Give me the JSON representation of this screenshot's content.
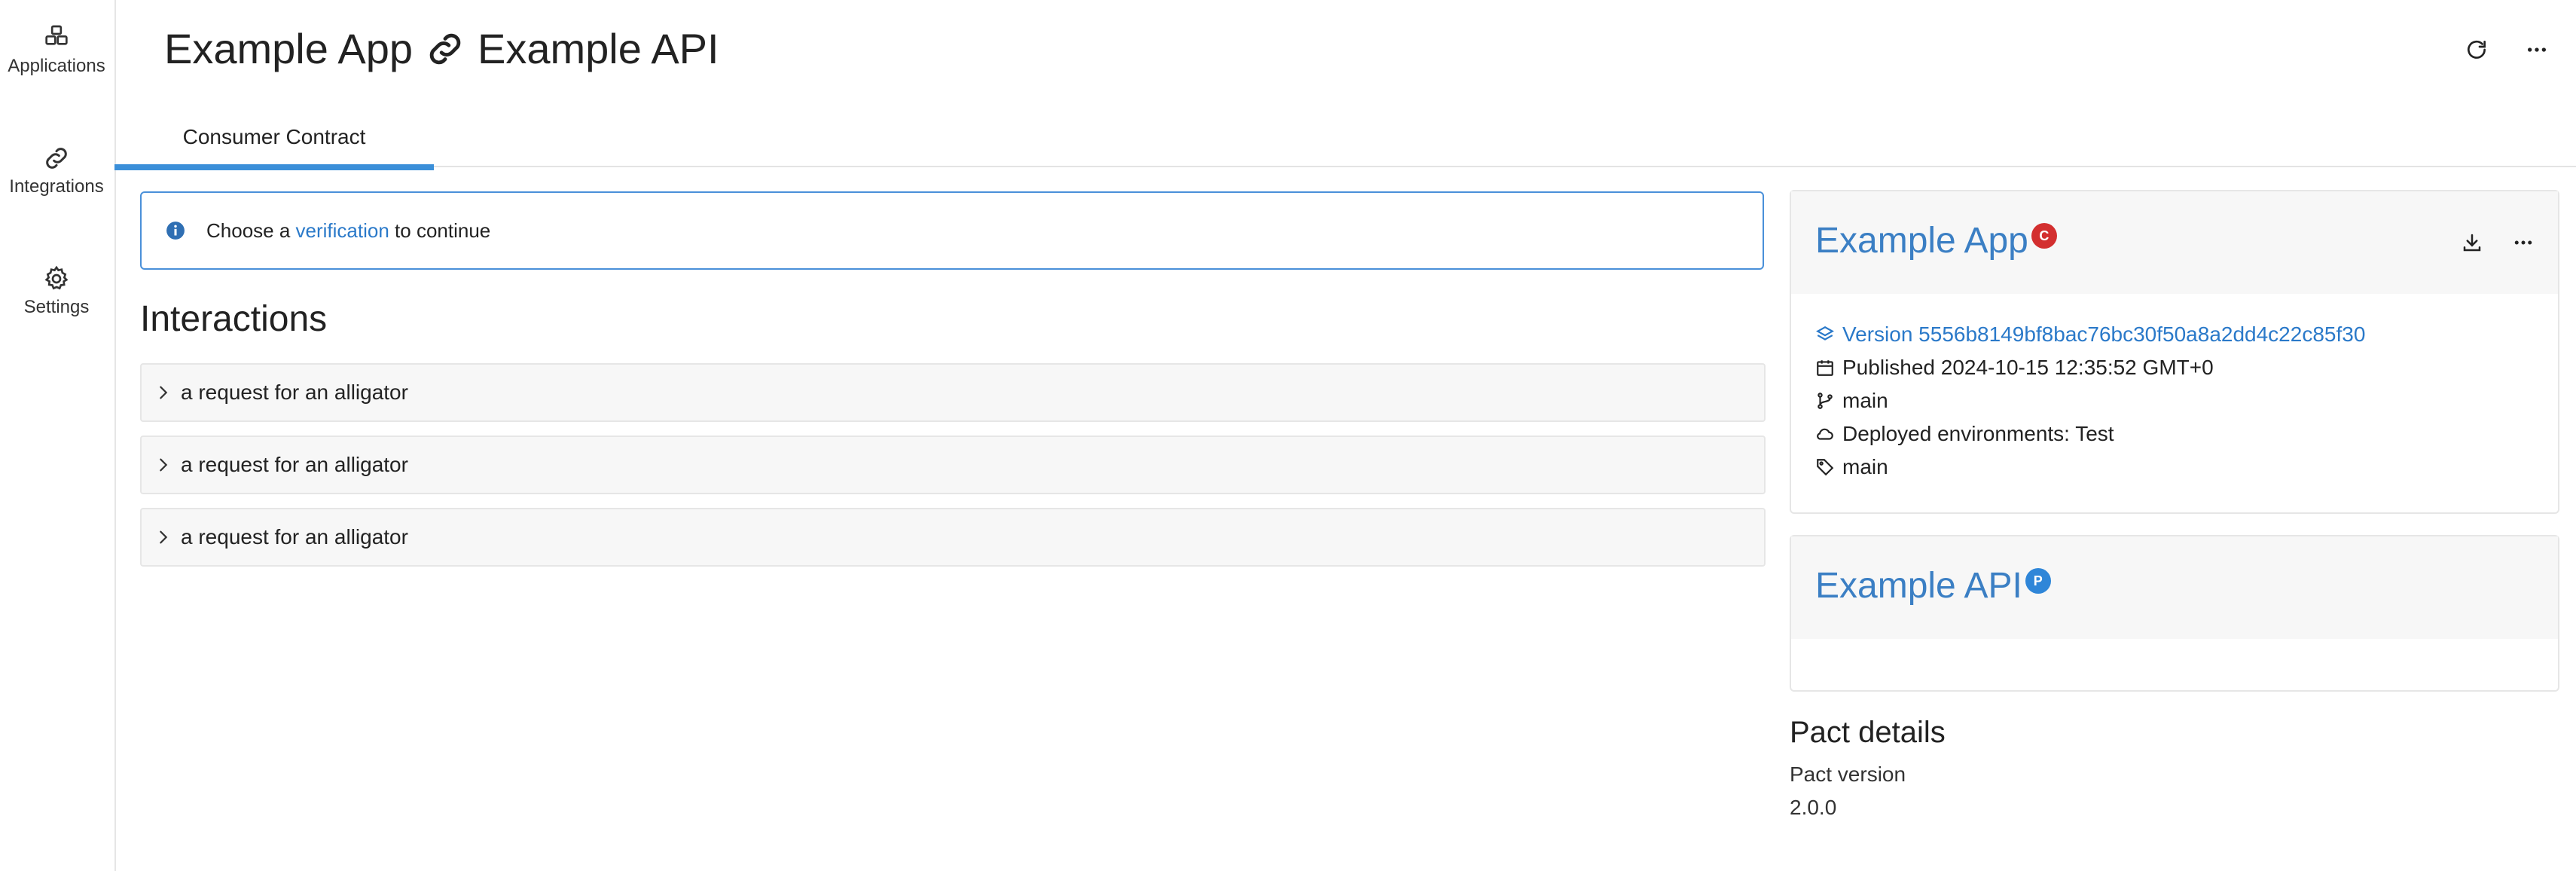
{
  "sidebar": {
    "items": [
      {
        "label": "Applications",
        "icon": "boxes-icon"
      },
      {
        "label": "Integrations",
        "icon": "link-icon"
      },
      {
        "label": "Settings",
        "icon": "gear-icon"
      }
    ]
  },
  "header": {
    "consumer": "Example App",
    "provider": "Example API"
  },
  "tabs": [
    {
      "label": "Consumer Contract",
      "active": true
    }
  ],
  "alert": {
    "prefix": "Choose a ",
    "link": "verification",
    "suffix": " to continue"
  },
  "interactions": {
    "title": "Interactions",
    "items": [
      "a request for an alligator",
      "a request for an alligator",
      "a request for an alligator"
    ]
  },
  "consumer_card": {
    "title": "Example App",
    "badge": "C",
    "version": "Version 5556b8149bf8bac76bc30f50a8a2dd4c22c85f30",
    "published": "Published 2024-10-15 12:35:52 GMT+0",
    "branch": "main",
    "environments": "Deployed environments: Test",
    "tag": "main"
  },
  "provider_card": {
    "title": "Example API",
    "badge": "P"
  },
  "pact_details": {
    "title": "Pact details",
    "version_label": "Pact version",
    "version_value": "2.0.0"
  },
  "colors": {
    "accent": "#3b8fd9",
    "link": "#2a79c9",
    "consumer_badge": "#d32f2f",
    "provider_badge": "#2f86d8"
  }
}
